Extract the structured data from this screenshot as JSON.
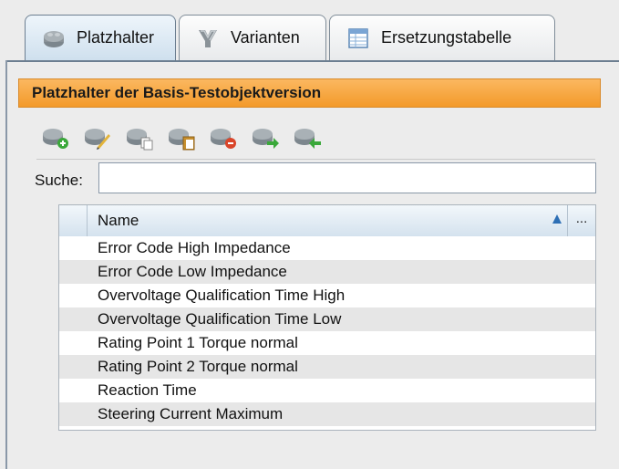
{
  "tabs": [
    {
      "label": "Platzhalter",
      "icon": "brick-icon",
      "active": true
    },
    {
      "label": "Varianten",
      "icon": "variant-icon",
      "active": false
    },
    {
      "label": "Ersetzungstabelle",
      "icon": "table-icon",
      "active": false
    }
  ],
  "panel": {
    "title": "Platzhalter der Basis-Testobjektversion"
  },
  "toolbar": {
    "buttons": [
      {
        "icon": "add-brick-icon"
      },
      {
        "icon": "edit-brick-icon"
      },
      {
        "icon": "copy-brick-icon"
      },
      {
        "icon": "paste-brick-icon"
      },
      {
        "icon": "delete-brick-icon"
      },
      {
        "icon": "export-brick-icon"
      },
      {
        "icon": "import-brick-icon"
      }
    ]
  },
  "search": {
    "label": "Suche:",
    "value": ""
  },
  "table": {
    "column_name": "Name",
    "more_button": "...",
    "rows": [
      "Error Code High Impedance",
      "Error Code Low Impedance",
      "Overvoltage Qualification Time High",
      "Overvoltage Qualification Time Low",
      "Rating Point  1 Torque normal",
      "Rating Point  2 Torque normal",
      "Reaction Time",
      "Steering Current Maximum"
    ]
  },
  "colors": {
    "header_orange": "#f39a2a",
    "brick_gray": "#8a9298",
    "accent_blue": "#2d6fb5"
  }
}
